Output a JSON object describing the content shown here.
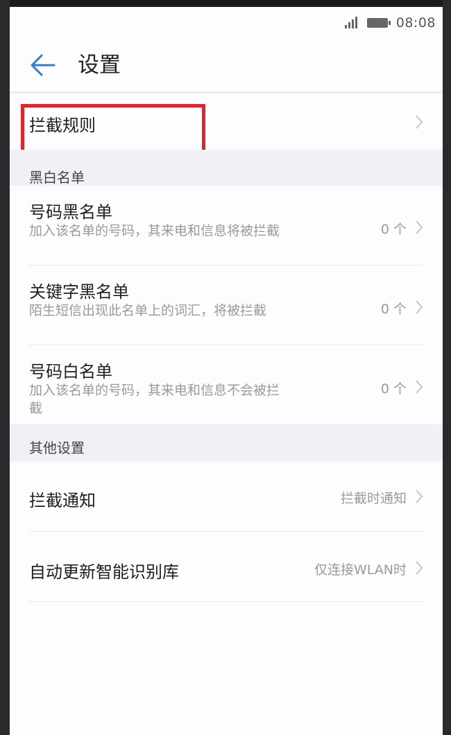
{
  "status": {
    "time": "08:08"
  },
  "header": {
    "title": "设置"
  },
  "rules_item": {
    "label": "拦截规则"
  },
  "section_blackwhite": {
    "label": "黑白名单"
  },
  "number_blacklist": {
    "title": "号码黑名单",
    "subtitle": "加入该名单的号码，其来电和信息将被拦截",
    "value": "0 个"
  },
  "keyword_blacklist": {
    "title": "关键字黑名单",
    "subtitle": "陌生短信出现此名单上的词汇，将被拦截",
    "value": "0 个"
  },
  "number_whitelist": {
    "title": "号码白名单",
    "subtitle": "加入该名单的号码，其来电和信息不会被拦截",
    "value": "0 个"
  },
  "section_other": {
    "label": "其他设置"
  },
  "block_notify": {
    "title": "拦截通知",
    "value": "拦截时通知"
  },
  "auto_update": {
    "title": "自动更新智能识别库",
    "value": "仅连接WLAN时"
  },
  "colors": {
    "accent": "#2f7fd1",
    "highlight": "#e0262b",
    "section_bg": "#f1f0f4"
  }
}
